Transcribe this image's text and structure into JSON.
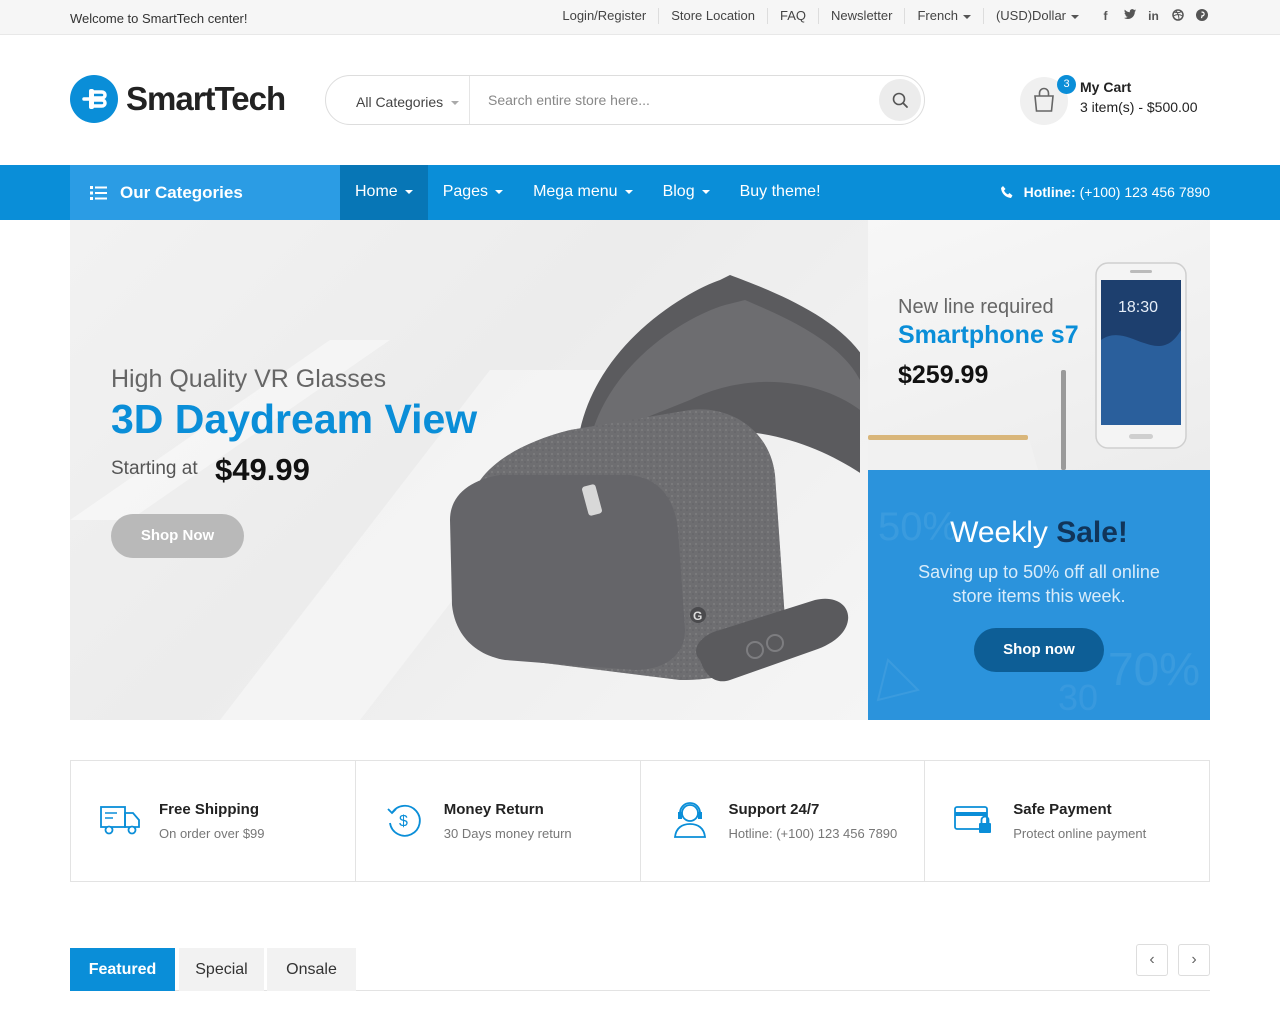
{
  "topbar": {
    "welcome": "Welcome to SmartTech center!",
    "links": [
      "Login/Register",
      "Store Location",
      "FAQ",
      "Newsletter"
    ],
    "language": "French",
    "currency": "(USD)Dollar",
    "social": [
      "facebook-icon",
      "twitter-icon",
      "linkedin-icon",
      "dribbble-icon",
      "pinterest-icon"
    ]
  },
  "header": {
    "logo_text": "SmartTech",
    "search": {
      "category": "All Categories",
      "placeholder": "Search entire store here..."
    },
    "cart": {
      "count": "3",
      "title": "My Cart",
      "summary": "3 item(s) - $500.00"
    }
  },
  "nav": {
    "categories_label": "Our Categories",
    "items": [
      "Home",
      "Pages",
      "Mega menu",
      "Blog",
      "Buy theme!"
    ],
    "hotline_label": "Hotline:",
    "hotline_value": "(+100) 123 456 7890"
  },
  "hero": {
    "subtitle": "High Quality VR Glasses",
    "title": "3D Daydream View",
    "starting": "Starting at",
    "price": "$49.99",
    "button": "Shop Now"
  },
  "phone_banner": {
    "line1": "New line required",
    "line2": "Smartphone s7",
    "price": "$259.99"
  },
  "sale_banner": {
    "title_part1": "Weekly",
    "title_part2": "Sale!",
    "text": "Saving up to 50% off all online store items this week.",
    "button": "Shop now"
  },
  "features": [
    {
      "title": "Free Shipping",
      "sub": "On order over $99"
    },
    {
      "title": "Money Return",
      "sub": "30 Days money return"
    },
    {
      "title": "Support 24/7",
      "sub": "Hotline: (+100) 123 456 7890"
    },
    {
      "title": "Safe Payment",
      "sub": "Protect online payment"
    }
  ],
  "tabs": [
    "Featured",
    "Special",
    "Onsale"
  ],
  "colors": {
    "accent": "#0a8ed8",
    "accent_dark": "#0776b6",
    "sale_bg": "#2b93dc"
  }
}
